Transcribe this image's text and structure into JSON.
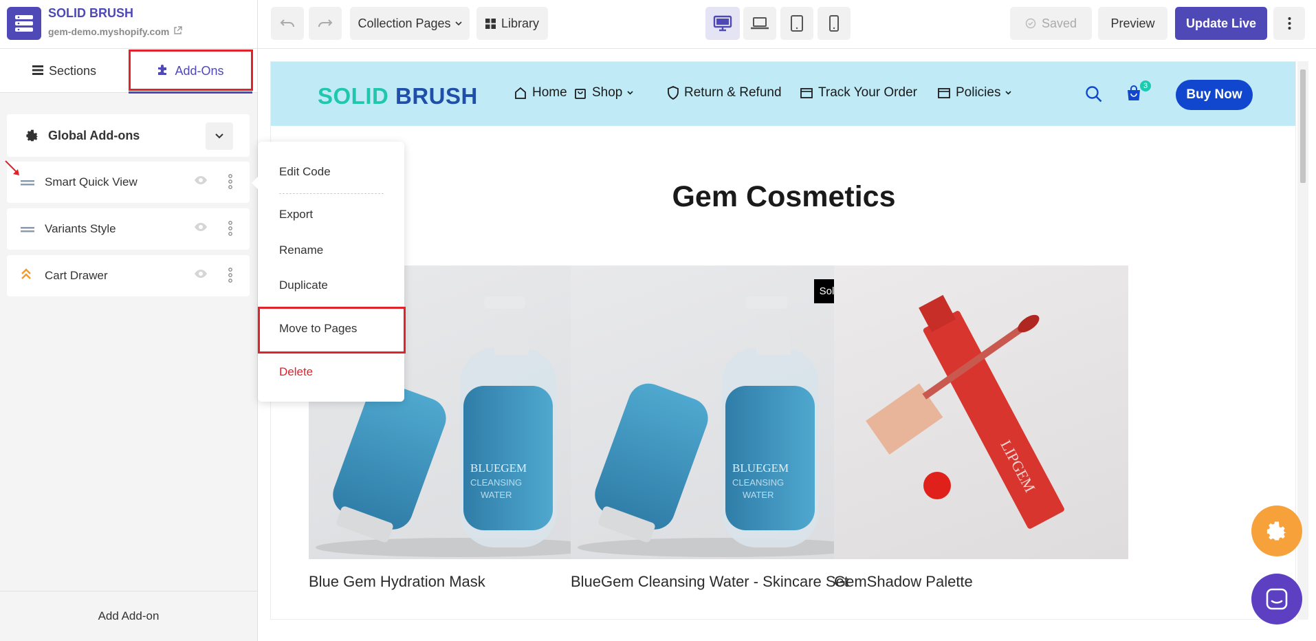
{
  "brand": {
    "title": "SOLID BRUSH",
    "domain": "gem-demo.myshopify.com"
  },
  "toolbar": {
    "page_select": "Collection Pages",
    "library_label": "Library",
    "saved_label": "Saved",
    "preview_label": "Preview",
    "update_label": "Update Live",
    "accent_color": "#4e49b7"
  },
  "panel_tabs": {
    "sections": "Sections",
    "addons": "Add-Ons"
  },
  "global_addons": {
    "label": "Global Add-ons",
    "items": [
      {
        "name": "Smart Quick View",
        "icon": "drag-handle-icon"
      },
      {
        "name": "Variants Style",
        "icon": "drag-handle-icon"
      },
      {
        "name": "Cart Drawer",
        "icon": "double-chevron-up-icon"
      }
    ]
  },
  "add_addon_label": "Add Add-on",
  "context_menu": {
    "items": [
      "Edit Code",
      "Export",
      "Rename",
      "Duplicate",
      "Move to Pages"
    ],
    "delete": "Delete"
  },
  "store": {
    "logo_part1": "SOLID",
    "logo_part2": "BRUSH",
    "nav": [
      "Home",
      "Shop",
      "Return & Refund",
      "Track Your Order",
      "Policies"
    ],
    "cart_count": "3",
    "buy_now": "Buy Now",
    "collection_title": "Gem Cosmetics",
    "products": [
      {
        "name": "Blue Gem Hydration Mask",
        "badge": ""
      },
      {
        "name": "BlueGem Cleansing Water - Skincare Set",
        "badge": "Sold Out"
      },
      {
        "name": "GemShadow Palette",
        "badge": ""
      }
    ]
  }
}
